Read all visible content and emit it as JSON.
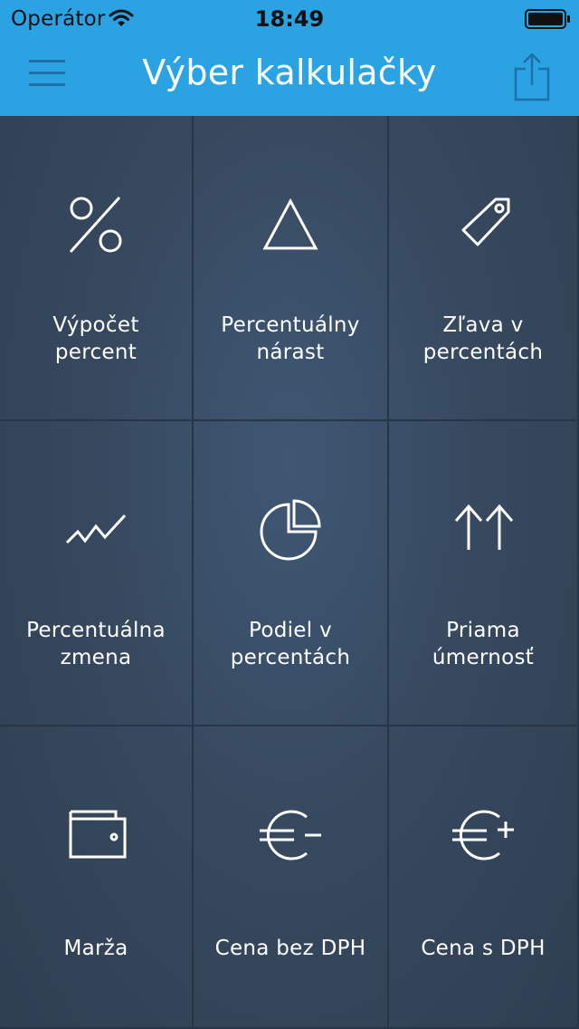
{
  "status_bar": {
    "carrier": "Operátor",
    "time": "18:49"
  },
  "header": {
    "title": "Výber kalkulačky"
  },
  "calculators": [
    {
      "line1": "Výpočet",
      "line2": "percent",
      "icon": "percent-icon"
    },
    {
      "line1": "Percentuálny",
      "line2": "nárast",
      "icon": "triangle-delta-icon"
    },
    {
      "line1": "Zľava v",
      "line2": "percentách",
      "icon": "price-tag-icon"
    },
    {
      "line1": "Percentuálna",
      "line2": "zmena",
      "icon": "trend-line-icon"
    },
    {
      "line1": "Podiel v",
      "line2": "percentách",
      "icon": "pie-chart-icon"
    },
    {
      "line1": "Priama",
      "line2": "úmernosť",
      "icon": "up-arrows-icon"
    },
    {
      "line1": "Marža",
      "line2": "",
      "icon": "wallet-icon"
    },
    {
      "line1": "Cena bez DPH",
      "line2": "",
      "icon": "euro-minus-icon"
    },
    {
      "line1": "Cena s DPH",
      "line2": "",
      "icon": "euro-plus-icon"
    }
  ],
  "colors": {
    "header": "#2ba3e3",
    "grid_background": "#34475c",
    "grid_lines": "#273646",
    "icon_stroke": "#ffffff"
  }
}
